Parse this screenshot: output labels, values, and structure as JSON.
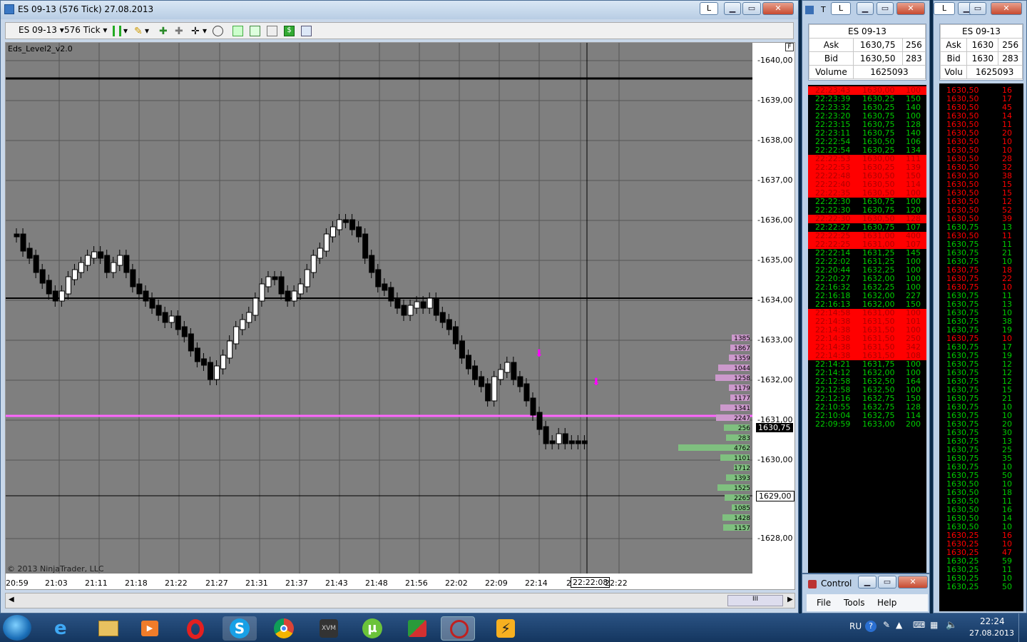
{
  "chart_window": {
    "title": "ES 09-13 (576 Tick)  27.08.2013",
    "btn_l": "L",
    "instrument": "ES 09-13",
    "interval": "576 Tick",
    "indicator_label": "Eds_Level2_v2.0",
    "copyright": "© 2013 NinjaTrader, LLC",
    "current_price_tag": "1630,75",
    "cursor_price_tag": "1629,00",
    "cursor_time_tag": "22:22:08",
    "price_labels": [
      "1640,00",
      "1639,00",
      "1638,00",
      "1637,00",
      "1636,00",
      "1635,00",
      "1634,00",
      "1633,00",
      "1632,00",
      "1631,00",
      "1630,00",
      "1628,00"
    ],
    "time_labels": [
      "20:59",
      "21:03",
      "21:11",
      "21:18",
      "21:22",
      "21:27",
      "21:31",
      "21:37",
      "21:43",
      "21:48",
      "21:56",
      "22:02",
      "22:09",
      "22:14",
      "2",
      "22:22"
    ],
    "scroll_label": "III",
    "ask_book_values": [
      "1385",
      "1867",
      "1359",
      "1044",
      "1258",
      "1179",
      "1177",
      "1341",
      "2247"
    ],
    "bid_book_values": [
      "256",
      "283",
      "4762",
      "1101",
      "1712",
      "1393",
      "1525",
      "2265",
      "1085",
      "1428",
      "1157"
    ]
  },
  "tape_window_1": {
    "title_letter": "T",
    "btn_l": "L",
    "instrument": "ES 09-13",
    "ask_label": "Ask",
    "ask_price": "1630,75",
    "ask_size": "256",
    "bid_label": "Bid",
    "bid_price": "1630,50",
    "bid_size": "283",
    "volume_label": "Volume",
    "volume": "1625093",
    "trades": [
      {
        "time": "22:23:43",
        "price": "1630,00",
        "size": "100",
        "side": "sell"
      },
      {
        "time": "22:23:39",
        "price": "1630,25",
        "size": "150",
        "side": "buy"
      },
      {
        "time": "22:23:32",
        "price": "1630,25",
        "size": "140",
        "side": "buy"
      },
      {
        "time": "22:23:20",
        "price": "1630,75",
        "size": "100",
        "side": "buy"
      },
      {
        "time": "22:23:15",
        "price": "1630,75",
        "size": "128",
        "side": "buy"
      },
      {
        "time": "22:23:11",
        "price": "1630,75",
        "size": "140",
        "side": "buy"
      },
      {
        "time": "22:22:54",
        "price": "1630,50",
        "size": "106",
        "side": "buy"
      },
      {
        "time": "22:22:54",
        "price": "1630,25",
        "size": "134",
        "side": "buy"
      },
      {
        "time": "22:22:53",
        "price": "1630,00",
        "size": "111",
        "side": "sell"
      },
      {
        "time": "22:22:53",
        "price": "1630,25",
        "size": "139",
        "side": "sell"
      },
      {
        "time": "22:22:48",
        "price": "1630,50",
        "size": "150",
        "side": "sell"
      },
      {
        "time": "22:22:40",
        "price": "1630,50",
        "size": "114",
        "side": "sell"
      },
      {
        "time": "22:22:35",
        "price": "1630,50",
        "size": "100",
        "side": "sell"
      },
      {
        "time": "22:22:30",
        "price": "1630,75",
        "size": "100",
        "side": "buy"
      },
      {
        "time": "22:22:30",
        "price": "1630,75",
        "size": "120",
        "side": "buy"
      },
      {
        "time": "22:22:30",
        "price": "1630,50",
        "size": "128",
        "side": "sell"
      },
      {
        "time": "22:22:27",
        "price": "1630,75",
        "size": "107",
        "side": "buy"
      },
      {
        "time": "22:22:25",
        "price": "1631,00",
        "size": "400",
        "side": "sell"
      },
      {
        "time": "22:22:25",
        "price": "1631,00",
        "size": "107",
        "side": "sell"
      },
      {
        "time": "22:22:14",
        "price": "1631,25",
        "size": "145",
        "side": "buy"
      },
      {
        "time": "22:22:02",
        "price": "1631,25",
        "size": "100",
        "side": "buy"
      },
      {
        "time": "22:20:44",
        "price": "1632,25",
        "size": "100",
        "side": "buy"
      },
      {
        "time": "22:20:27",
        "price": "1632,00",
        "size": "100",
        "side": "buy"
      },
      {
        "time": "22:16:32",
        "price": "1632,25",
        "size": "100",
        "side": "buy"
      },
      {
        "time": "22:16:18",
        "price": "1632,00",
        "size": "227",
        "side": "buy"
      },
      {
        "time": "22:16:13",
        "price": "1632,00",
        "size": "150",
        "side": "buy"
      },
      {
        "time": "22:14:58",
        "price": "1631,00",
        "size": "100",
        "side": "sell"
      },
      {
        "time": "22:14:38",
        "price": "1631,50",
        "size": "101",
        "side": "sell"
      },
      {
        "time": "22:14:38",
        "price": "1631,50",
        "size": "100",
        "side": "sell"
      },
      {
        "time": "22:14:38",
        "price": "1631,50",
        "size": "250",
        "side": "sell"
      },
      {
        "time": "22:14:38",
        "price": "1631,50",
        "size": "342",
        "side": "sell"
      },
      {
        "time": "22:14:38",
        "price": "1631,50",
        "size": "108",
        "side": "sell"
      },
      {
        "time": "22:14:21",
        "price": "1631,75",
        "size": "100",
        "side": "buy"
      },
      {
        "time": "22:14:12",
        "price": "1632,00",
        "size": "100",
        "side": "buy"
      },
      {
        "time": "22:12:58",
        "price": "1632,50",
        "size": "164",
        "side": "buy"
      },
      {
        "time": "22:12:58",
        "price": "1632,50",
        "size": "100",
        "side": "buy"
      },
      {
        "time": "22:12:16",
        "price": "1632,75",
        "size": "150",
        "side": "buy"
      },
      {
        "time": "22:10:55",
        "price": "1632,75",
        "size": "128",
        "side": "buy"
      },
      {
        "time": "22:10:04",
        "price": "1632,75",
        "size": "114",
        "side": "buy"
      },
      {
        "time": "22:09:59",
        "price": "1633,00",
        "size": "200",
        "side": "buy"
      }
    ]
  },
  "tape_window_2": {
    "btn_l": "L",
    "instrument": "ES 09-13",
    "ask_label": "Ask",
    "ask_price": "1630",
    "ask_size": "256",
    "bid_label": "Bid",
    "bid_price": "1630",
    "bid_size": "283",
    "volume_label": "Volu",
    "volume": "1625093",
    "trades": [
      {
        "price": "1630,50",
        "size": "16",
        "side": "sell"
      },
      {
        "price": "1630,50",
        "size": "17",
        "side": "sell"
      },
      {
        "price": "1630,50",
        "size": "45",
        "side": "sell"
      },
      {
        "price": "1630,50",
        "size": "14",
        "side": "sell"
      },
      {
        "price": "1630,50",
        "size": "11",
        "side": "sell"
      },
      {
        "price": "1630,50",
        "size": "20",
        "side": "sell"
      },
      {
        "price": "1630,50",
        "size": "10",
        "side": "sell"
      },
      {
        "price": "1630,50",
        "size": "10",
        "side": "sell"
      },
      {
        "price": "1630,50",
        "size": "28",
        "side": "sell"
      },
      {
        "price": "1630,50",
        "size": "32",
        "side": "sell"
      },
      {
        "price": "1630,50",
        "size": "38",
        "side": "sell"
      },
      {
        "price": "1630,50",
        "size": "15",
        "side": "sell"
      },
      {
        "price": "1630,50",
        "size": "15",
        "side": "sell"
      },
      {
        "price": "1630,50",
        "size": "12",
        "side": "sell"
      },
      {
        "price": "1630,50",
        "size": "52",
        "side": "sell"
      },
      {
        "price": "1630,50",
        "size": "39",
        "side": "sell"
      },
      {
        "price": "1630,75",
        "size": "13",
        "side": "buy"
      },
      {
        "price": "1630,50",
        "size": "11",
        "side": "sell"
      },
      {
        "price": "1630,75",
        "size": "11",
        "side": "buy"
      },
      {
        "price": "1630,75",
        "size": "21",
        "side": "buy"
      },
      {
        "price": "1630,75",
        "size": "10",
        "side": "buy"
      },
      {
        "price": "1630,75",
        "size": "18",
        "side": "sell"
      },
      {
        "price": "1630,75",
        "size": "22",
        "side": "sell"
      },
      {
        "price": "1630,75",
        "size": "10",
        "side": "sell"
      },
      {
        "price": "1630,75",
        "size": "11",
        "side": "buy"
      },
      {
        "price": "1630,75",
        "size": "13",
        "side": "buy"
      },
      {
        "price": "1630,75",
        "size": "10",
        "side": "buy"
      },
      {
        "price": "1630,75",
        "size": "38",
        "side": "buy"
      },
      {
        "price": "1630,75",
        "size": "19",
        "side": "buy"
      },
      {
        "price": "1630,75",
        "size": "10",
        "side": "sell"
      },
      {
        "price": "1630,75",
        "size": "17",
        "side": "buy"
      },
      {
        "price": "1630,75",
        "size": "19",
        "side": "buy"
      },
      {
        "price": "1630,75",
        "size": "12",
        "side": "buy"
      },
      {
        "price": "1630,75",
        "size": "12",
        "side": "buy"
      },
      {
        "price": "1630,75",
        "size": "12",
        "side": "buy"
      },
      {
        "price": "1630,75",
        "size": "15",
        "side": "buy"
      },
      {
        "price": "1630,75",
        "size": "21",
        "side": "buy"
      },
      {
        "price": "1630,75",
        "size": "10",
        "side": "buy"
      },
      {
        "price": "1630,75",
        "size": "10",
        "side": "buy"
      },
      {
        "price": "1630,75",
        "size": "20",
        "side": "buy"
      },
      {
        "price": "1630,75",
        "size": "30",
        "side": "buy"
      },
      {
        "price": "1630,75",
        "size": "13",
        "side": "buy"
      },
      {
        "price": "1630,75",
        "size": "25",
        "side": "buy"
      },
      {
        "price": "1630,75",
        "size": "35",
        "side": "buy"
      },
      {
        "price": "1630,75",
        "size": "10",
        "side": "buy"
      },
      {
        "price": "1630,75",
        "size": "50",
        "side": "buy"
      },
      {
        "price": "1630,50",
        "size": "10",
        "side": "buy"
      },
      {
        "price": "1630,50",
        "size": "18",
        "side": "buy"
      },
      {
        "price": "1630,50",
        "size": "11",
        "side": "buy"
      },
      {
        "price": "1630,50",
        "size": "16",
        "side": "buy"
      },
      {
        "price": "1630,50",
        "size": "14",
        "side": "buy"
      },
      {
        "price": "1630,50",
        "size": "10",
        "side": "buy"
      },
      {
        "price": "1630,25",
        "size": "16",
        "side": "sell"
      },
      {
        "price": "1630,25",
        "size": "10",
        "side": "sell"
      },
      {
        "price": "1630,25",
        "size": "47",
        "side": "sell"
      },
      {
        "price": "1630,25",
        "size": "59",
        "side": "buy"
      },
      {
        "price": "1630,25",
        "size": "11",
        "side": "buy"
      },
      {
        "price": "1630,25",
        "size": "10",
        "side": "buy"
      },
      {
        "price": "1630,25",
        "size": "50",
        "side": "buy"
      }
    ]
  },
  "control_center": {
    "title": "Control",
    "menu": [
      "File",
      "Tools",
      "Help"
    ]
  },
  "taskbar": {
    "lang": "RU",
    "time": "22:24",
    "date": "27.08.2013"
  },
  "colors": {
    "sell": "#ff0000",
    "buy": "#00cc00",
    "plot_bg": "#7f7f7f",
    "level_line": "#ff66ff"
  }
}
